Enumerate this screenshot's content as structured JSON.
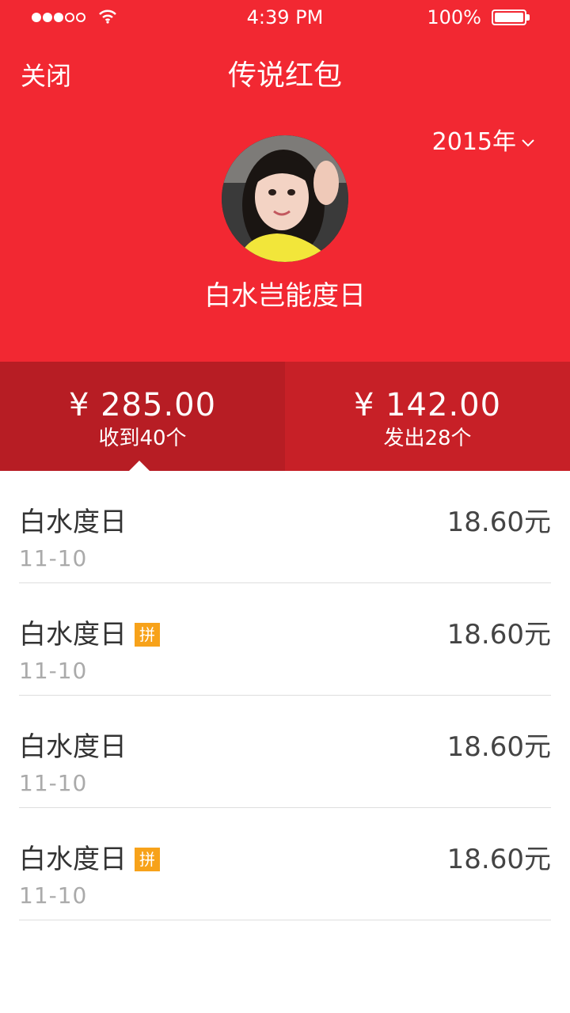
{
  "status_bar": {
    "time": "4:39 PM",
    "battery": "100%",
    "signal_icon": "signal-dots-icon",
    "wifi_icon": "wifi-icon",
    "battery_icon": "battery-icon"
  },
  "header": {
    "close_label": "关闭",
    "title": "传说红包",
    "year_label": "2015年",
    "year_icon": "chevron-down-icon",
    "user_name": "白水岂能度日",
    "bg_color": "#f22832"
  },
  "summary": {
    "received": {
      "amount": "¥ 285.00",
      "count_label": "收到40个"
    },
    "sent": {
      "amount": "¥ 142.00",
      "count_label": "发出28个"
    }
  },
  "records": [
    {
      "name": "白水度日",
      "date": "11-10",
      "amount": "18.60元",
      "tag": ""
    },
    {
      "name": "白水度日",
      "date": "11-10",
      "amount": "18.60元",
      "tag": "拼"
    },
    {
      "name": "白水度日",
      "date": "11-10",
      "amount": "18.60元",
      "tag": ""
    },
    {
      "name": "白水度日",
      "date": "11-10",
      "amount": "18.60元",
      "tag": "拼"
    }
  ]
}
